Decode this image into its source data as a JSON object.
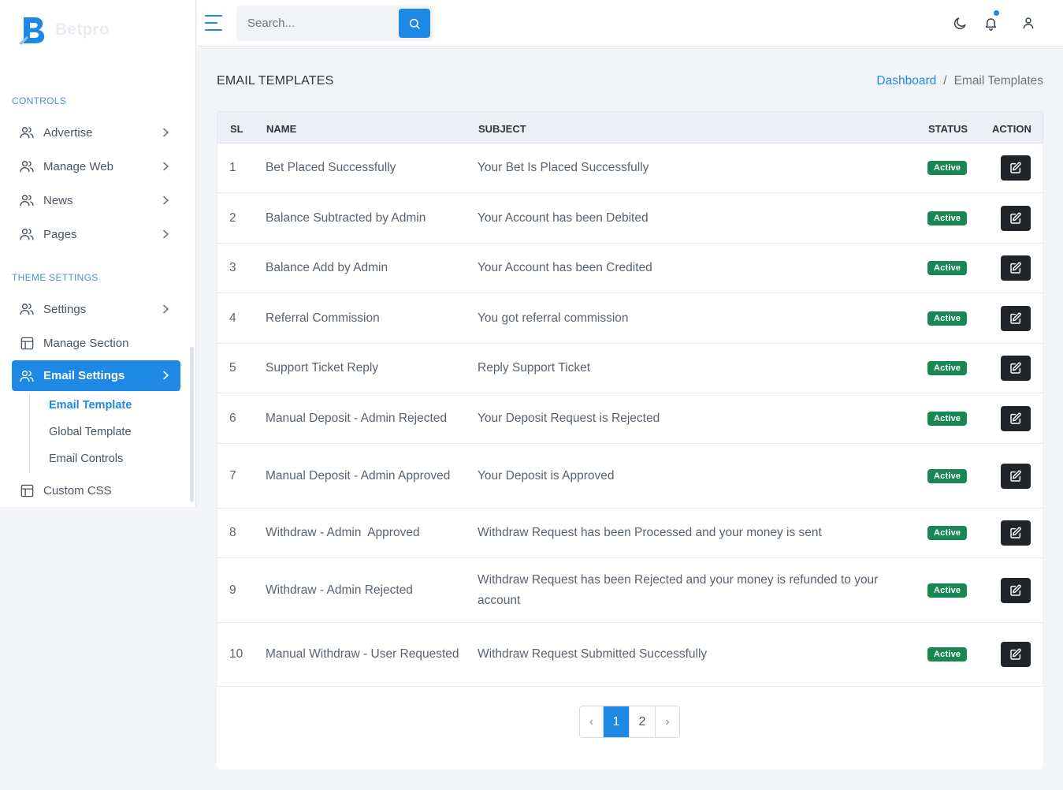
{
  "brand": {
    "name": "Betpro",
    "primary": "#1e88e5"
  },
  "sidebar": {
    "section_controls": "CONTROLS",
    "controls_items": [
      {
        "label": "Advertise",
        "icon": "users-icon"
      },
      {
        "label": "Manage Web",
        "icon": "users-icon"
      },
      {
        "label": "News",
        "icon": "users-icon"
      },
      {
        "label": "Pages",
        "icon": "users-icon"
      }
    ],
    "section_theme": "THEME SETTINGS",
    "theme_items": [
      {
        "label": "Settings",
        "icon": "users-icon"
      },
      {
        "label": "Manage Section",
        "icon": "layout-icon"
      },
      {
        "label": "Email Settings",
        "icon": "users-icon"
      }
    ],
    "email_sub_items": [
      "Email Template",
      "Global Template",
      "Email Controls"
    ],
    "custom_css": "Custom CSS"
  },
  "topbar": {
    "search_placeholder": "Search..."
  },
  "page": {
    "title": "EMAIL TEMPLATES",
    "breadcrumb_home": "Dashboard",
    "breadcrumb_sep": "/",
    "breadcrumb_current": "Email Templates"
  },
  "table": {
    "headers": {
      "sl": "SL",
      "name": "NAME",
      "subject": "SUBJECT",
      "status": "STATUS",
      "action": "ACTION"
    },
    "rows": [
      {
        "sl": "1",
        "name": "Bet Placed Successfully",
        "subject": "Your Bet Is Placed Successfully",
        "status": "Active"
      },
      {
        "sl": "2",
        "name": "Balance Subtracted by Admin",
        "subject": "Your Account has been Debited",
        "status": "Active"
      },
      {
        "sl": "3",
        "name": "Balance Add by Admin",
        "subject": "Your Account has been Credited",
        "status": "Active"
      },
      {
        "sl": "4",
        "name": "Referral Commission",
        "subject": "You got referral commission",
        "status": "Active"
      },
      {
        "sl": "5",
        "name": "Support Ticket Reply",
        "subject": "Reply Support Ticket",
        "status": "Active"
      },
      {
        "sl": "6",
        "name": "Manual Deposit - Admin Rejected",
        "subject": "Your Deposit Request is Rejected",
        "status": "Active"
      },
      {
        "sl": "7",
        "name": "Manual Deposit - Admin Approved",
        "subject": "Your Deposit is Approved",
        "status": "Active"
      },
      {
        "sl": "8",
        "name": "Withdraw - Admin  Approved",
        "subject": "Withdraw Request has been Processed and your money is sent",
        "status": "Active"
      },
      {
        "sl": "9",
        "name": "Withdraw - Admin Rejected",
        "subject": "Withdraw Request has been Rejected and your money is refunded to your account",
        "status": "Active"
      },
      {
        "sl": "10",
        "name": "Manual Withdraw - User Requested",
        "subject": "Withdraw Request Submitted Successfully",
        "status": "Active"
      }
    ]
  },
  "pagination": {
    "prev": "‹",
    "pages": [
      "1",
      "2"
    ],
    "current": "1",
    "next": "›"
  }
}
